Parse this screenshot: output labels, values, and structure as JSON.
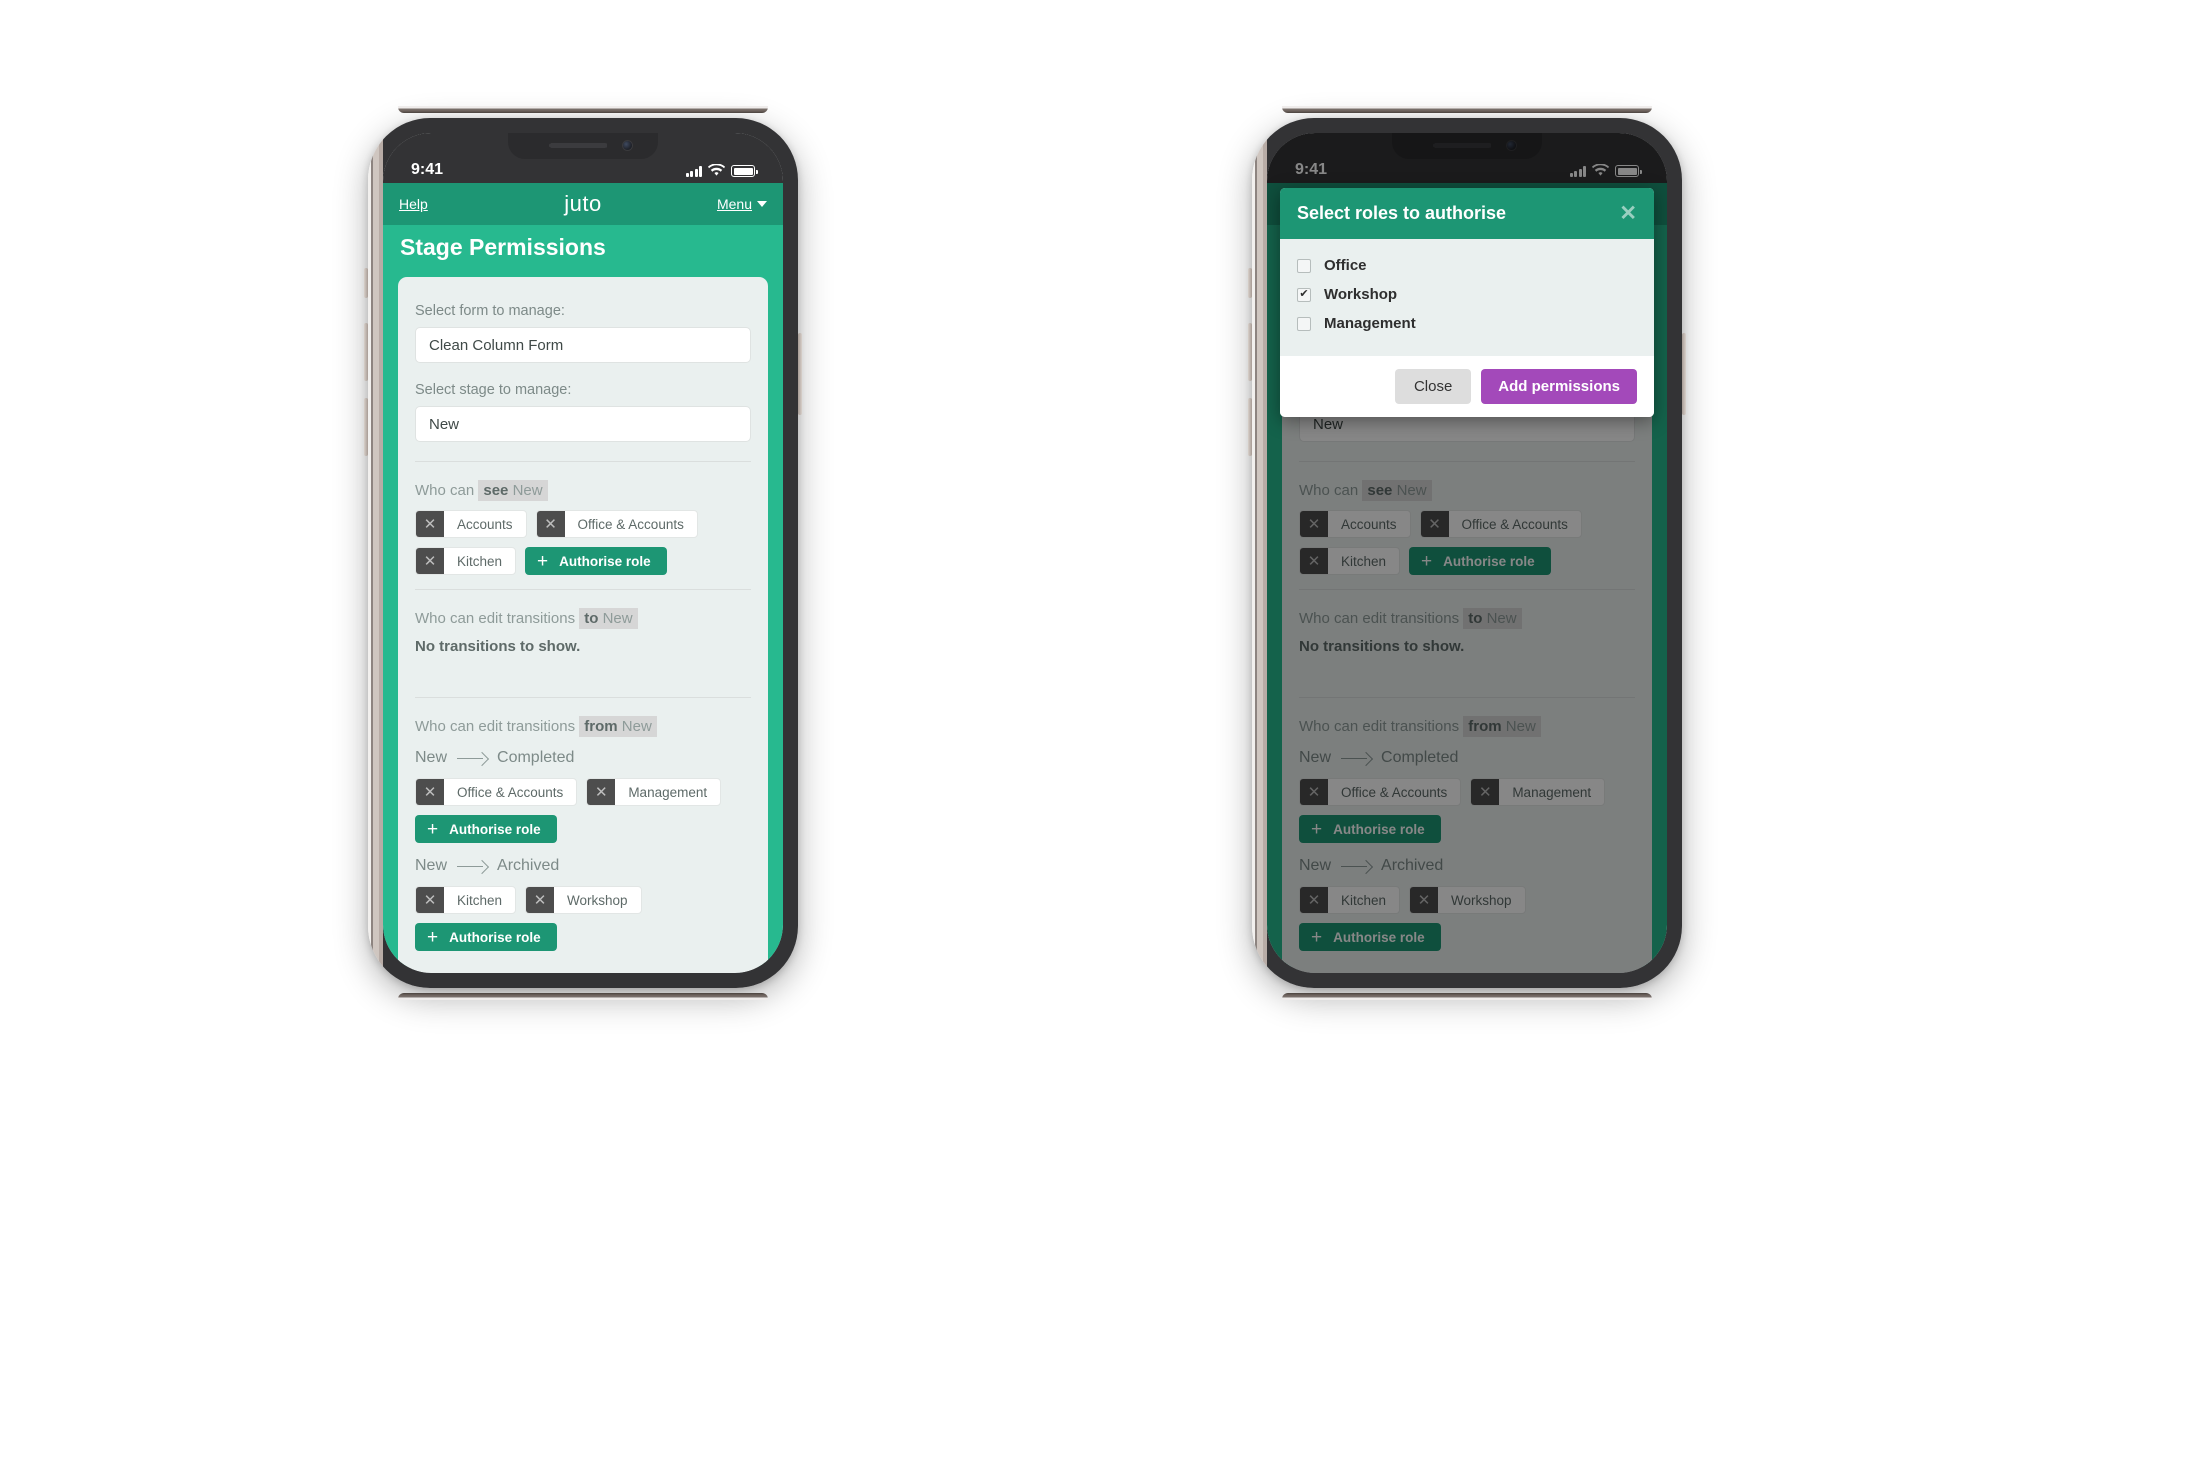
{
  "status_bar": {
    "time": "9:41"
  },
  "app_nav": {
    "help": "Help",
    "brand": "juto",
    "menu": "Menu"
  },
  "page": {
    "title": "Stage Permissions"
  },
  "form": {
    "form_label": "Select form to manage:",
    "form_value": "Clean Column Form",
    "stage_label": "Select stage to manage:",
    "stage_value": "New"
  },
  "sections": {
    "see": {
      "prefix": "Who can",
      "verb": "see",
      "stage": "New",
      "roles": [
        "Accounts",
        "Office & Accounts",
        "Kitchen"
      ],
      "authorise_label": "Authorise role"
    },
    "to": {
      "prefix": "Who can edit transitions",
      "verb": "to",
      "stage": "New",
      "empty": "No transitions to show."
    },
    "from": {
      "prefix": "Who can edit transitions",
      "verb": "from",
      "stage": "New",
      "transitions": [
        {
          "source": "New",
          "target": "Completed",
          "roles": [
            "Office & Accounts",
            "Management"
          ],
          "authorise_label": "Authorise role"
        },
        {
          "source": "New",
          "target": "Archived",
          "roles": [
            "Kitchen",
            "Workshop"
          ],
          "authorise_label": "Authorise role"
        }
      ]
    }
  },
  "modal": {
    "title": "Select roles to authorise",
    "close_icon": "✕",
    "options": [
      {
        "label": "Office",
        "checked": false
      },
      {
        "label": "Workshop",
        "checked": true
      },
      {
        "label": "Management",
        "checked": false
      }
    ],
    "close_label": "Close",
    "add_label": "Add permissions"
  },
  "colors": {
    "nav_green": "#1d9674",
    "title_green": "#27b98f",
    "accent_purple": "#a349ba",
    "chip_x_dark": "#4d4d4d"
  }
}
